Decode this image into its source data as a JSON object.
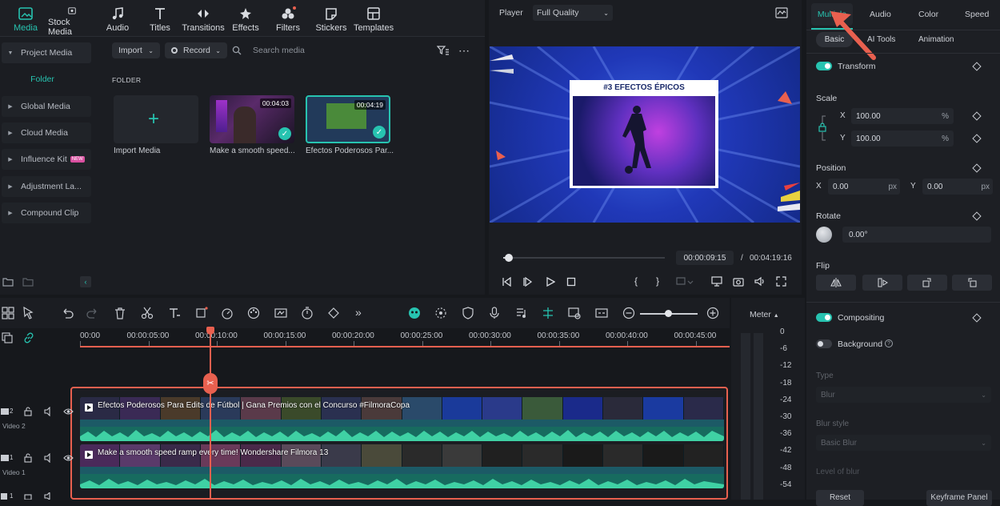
{
  "toolbar": {
    "tabs": [
      {
        "label": "Media",
        "icon": "media-icon",
        "active": true
      },
      {
        "label": "Stock Media",
        "icon": "stock-media-icon"
      },
      {
        "label": "Audio",
        "icon": "music-note-icon"
      },
      {
        "label": "Titles",
        "icon": "titles-icon"
      },
      {
        "label": "Transitions",
        "icon": "transitions-icon"
      },
      {
        "label": "Effects",
        "icon": "effects-icon"
      },
      {
        "label": "Filters",
        "icon": "filters-icon"
      },
      {
        "label": "Stickers",
        "icon": "stickers-icon"
      },
      {
        "label": "Templates",
        "icon": "templates-icon"
      }
    ]
  },
  "sidebar": {
    "items": [
      {
        "label": "Project Media"
      },
      {
        "label": "Folder"
      },
      {
        "label": "Global Media"
      },
      {
        "label": "Cloud Media"
      },
      {
        "label": "Influence Kit",
        "badge": "NEW"
      },
      {
        "label": "Adjustment La..."
      },
      {
        "label": "Compound Clip"
      }
    ]
  },
  "media": {
    "import_label": "Import",
    "record_label": "Record",
    "search_placeholder": "Search media",
    "folder_title": "FOLDER",
    "import_media_label": "Import Media",
    "clips": [
      {
        "name": "Make a smooth speed...",
        "duration": "00:04:03"
      },
      {
        "name": "Efectos Poderosos Par...",
        "duration": "00:04:19"
      }
    ]
  },
  "player": {
    "label": "Player",
    "quality": "Full Quality",
    "preview_title": "#3 EFECTOS ÉPICOS",
    "current_time": "00:00:09:15",
    "separator": "/",
    "total_time": "00:04:19:16",
    "progress": 0.035
  },
  "right_panel": {
    "tabs": [
      "Multiple",
      "Audio",
      "Color",
      "Speed"
    ],
    "subtabs": [
      "Basic",
      "AI Tools",
      "Animation"
    ],
    "transform_label": "Transform",
    "scale_label": "Scale",
    "scale_x_label": "X",
    "scale_x": "100.00",
    "scale_y_label": "Y",
    "scale_y": "100.00",
    "percent": "%",
    "position_label": "Position",
    "pos_x_label": "X",
    "pos_x": "0.00",
    "pos_y_label": "Y",
    "pos_y": "0.00",
    "px": "px",
    "rotate_label": "Rotate",
    "rotate_value": "0.00°",
    "flip_label": "Flip",
    "compositing_label": "Compositing",
    "background_label": "Background",
    "type_label": "Type",
    "type_value": "Blur",
    "blur_style_label": "Blur style",
    "blur_style_value": "Basic Blur",
    "level_label": "Level of blur",
    "reset_label": "Reset",
    "keyframe_label": "Keyframe Panel",
    "accent": "#27c3b0",
    "arrow_color": "#e8604f"
  },
  "timeline": {
    "ticks": [
      "00:00",
      "00:00:05:00",
      "00:00:10:00",
      "00:00:15:00",
      "00:00:20:00",
      "00:00:25:00",
      "00:00:30:00",
      "00:00:35:00",
      "00:00:40:00",
      "00:00:45:00"
    ],
    "tracks": [
      {
        "index": "2",
        "name": "Video 2",
        "clip_title": "Efectos Poderosos Para Edits de Fútbol | Gana Premios con el Concurso #FilmoraCopa"
      },
      {
        "index": "1",
        "name": "Video 1",
        "clip_title": "Make a smooth speed ramp every time! Wondershare Filmora 13"
      }
    ],
    "audio_track_index": "1"
  },
  "meter": {
    "label": "Meter",
    "levels": [
      "0",
      "-6",
      "-12",
      "-18",
      "-24",
      "-30",
      "-36",
      "-42",
      "-48",
      "-54"
    ]
  }
}
